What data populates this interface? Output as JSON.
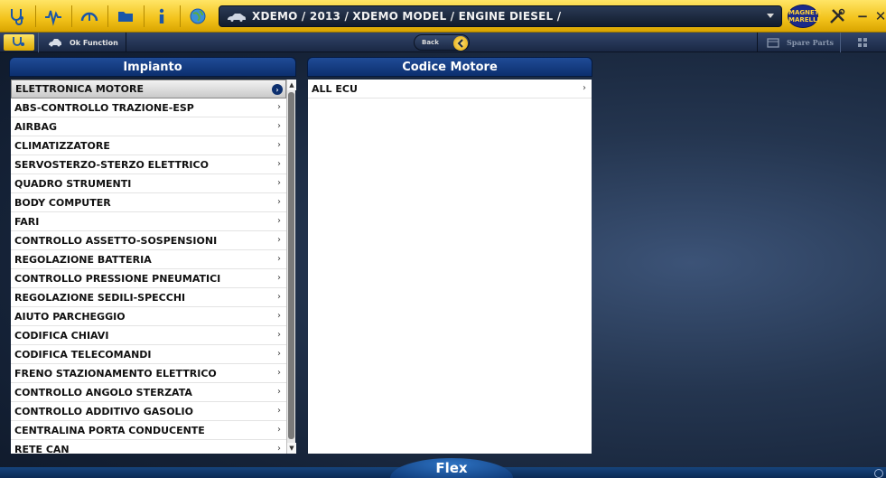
{
  "toolbar": {
    "breadcrumb": "XDEMO / 2013 / XDEMO MODEL / ENGINE DIESEL /",
    "logo_line1": "MAGNETI",
    "logo_line2": "MARELLI",
    "minimize_label": "−",
    "close_label": "✕",
    "icons": [
      "stethoscope-icon",
      "waveform-icon",
      "gauge-icon",
      "folder-icon",
      "info-icon",
      "globe-icon",
      "car-icon",
      "dropdown-icon",
      "tools-icon"
    ]
  },
  "subbar": {
    "ok_function_label": "Ok Function",
    "back_label": "Back",
    "spare_parts_label": "Spare Parts"
  },
  "left_panel": {
    "title": "Impianto",
    "items": [
      {
        "label": "ELETTRONICA MOTORE",
        "selected": true
      },
      {
        "label": "ABS-CONTROLLO TRAZIONE-ESP"
      },
      {
        "label": "AIRBAG"
      },
      {
        "label": "CLIMATIZZATORE"
      },
      {
        "label": "SERVOSTERZO-STERZO ELETTRICO"
      },
      {
        "label": "QUADRO STRUMENTI"
      },
      {
        "label": "BODY COMPUTER"
      },
      {
        "label": "FARI"
      },
      {
        "label": "CONTROLLO ASSETTO-SOSPENSIONI"
      },
      {
        "label": "REGOLAZIONE BATTERIA"
      },
      {
        "label": "CONTROLLO PRESSIONE PNEUMATICI"
      },
      {
        "label": "REGOLAZIONE SEDILI-SPECCHI"
      },
      {
        "label": "AIUTO PARCHEGGIO"
      },
      {
        "label": "CODIFICA CHIAVI"
      },
      {
        "label": "CODIFICA TELECOMANDI"
      },
      {
        "label": "FRENO STAZIONAMENTO ELETTRICO"
      },
      {
        "label": "CONTROLLO ANGOLO STERZATA"
      },
      {
        "label": "CONTROLLO ADDITIVO GASOLIO"
      },
      {
        "label": "CENTRALINA PORTA CONDUCENTE"
      },
      {
        "label": "RETE CAN"
      }
    ]
  },
  "right_panel": {
    "title": "Codice Motore",
    "items": [
      {
        "label": "ALL ECU"
      }
    ]
  },
  "bottom": {
    "tab_label": "Flex"
  },
  "colors": {
    "toolbar_yellow": "#f2c21a",
    "panel_header_blue": "#0c2f6e",
    "background_navy": "#1a2a44"
  }
}
